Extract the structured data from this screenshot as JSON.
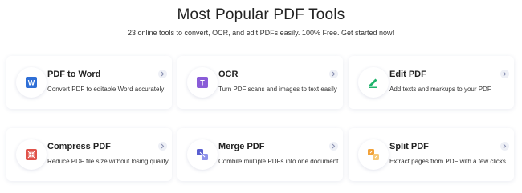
{
  "header": {
    "title": "Most Popular PDF Tools",
    "subtitle": "23 online tools to convert, OCR, and edit PDFs easily. 100% Free. Get started now!"
  },
  "tools": [
    {
      "title": "PDF to Word",
      "description": "Convert PDF to editable Word accurately",
      "icon": "word-icon",
      "color": "#2f6fd6"
    },
    {
      "title": "OCR",
      "description": "Turn PDF scans and images to text easily",
      "icon": "ocr-icon",
      "color": "#8a5cd8"
    },
    {
      "title": "Edit PDF",
      "description": "Add texts and markups to your PDF",
      "icon": "edit-pen-icon",
      "color": "#1fb36b"
    },
    {
      "title": "Compress PDF",
      "description": "Reduce PDF file size without losing quality",
      "icon": "compress-icon",
      "color": "#e0524a"
    },
    {
      "title": "Merge PDF",
      "description": "Combile multiple PDFs into one document",
      "icon": "merge-icon",
      "color": "#5a5fd1"
    },
    {
      "title": "Split PDF",
      "description": "Extract pages from PDF with a few clicks",
      "icon": "split-icon",
      "color": "#f2a23a"
    }
  ]
}
